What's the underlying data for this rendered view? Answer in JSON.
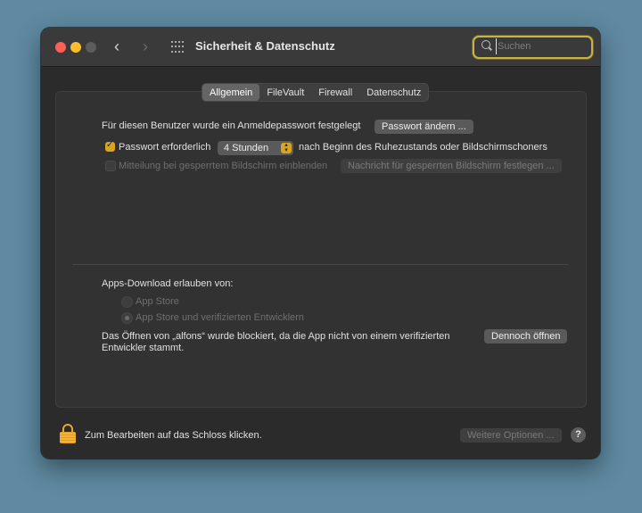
{
  "window": {
    "title": "Sicherheit & Datenschutz",
    "search_placeholder": "Suchen",
    "search_value": ""
  },
  "tabs": [
    {
      "label": "Allgemein",
      "active": true
    },
    {
      "label": "FileVault",
      "active": false
    },
    {
      "label": "Firewall",
      "active": false
    },
    {
      "label": "Datenschutz",
      "active": false
    }
  ],
  "general": {
    "password_set_text": "Für diesen Benutzer wurde ein Anmeldepasswort festgelegt",
    "change_password_button": "Passwort ändern ...",
    "require_password_label": "Passwort erforderlich",
    "require_password_checked": true,
    "require_password_delay": "4 Stunden",
    "require_password_suffix": "nach Beginn des Ruhezustands oder Bildschirmschoners",
    "show_message_label": "Mitteilung bei gesperrtem Bildschirm einblenden",
    "show_message_checked": false,
    "set_message_button": "Nachricht für gesperrten Bildschirm festlegen ..."
  },
  "downloads": {
    "heading": "Apps-Download erlauben von:",
    "options": [
      {
        "label": "App Store",
        "selected": false
      },
      {
        "label": "App Store und verifizierten Entwicklern",
        "selected": true
      }
    ],
    "blocked_line1": "Das Öffnen von „alfons“ wurde blockiert, da die App nicht von einem verifizierten",
    "blocked_line2": "Entwickler stammt.",
    "open_anyway_button": "Dennoch öffnen"
  },
  "footer": {
    "lock_text": "Zum Bearbeiten auf das Schloss klicken.",
    "advanced_button": "Weitere Optionen ...",
    "help_label": "?"
  },
  "colors": {
    "accent": "#d8a521",
    "search_focus": "#c9b53e",
    "desktop": "#5f8aa1"
  }
}
